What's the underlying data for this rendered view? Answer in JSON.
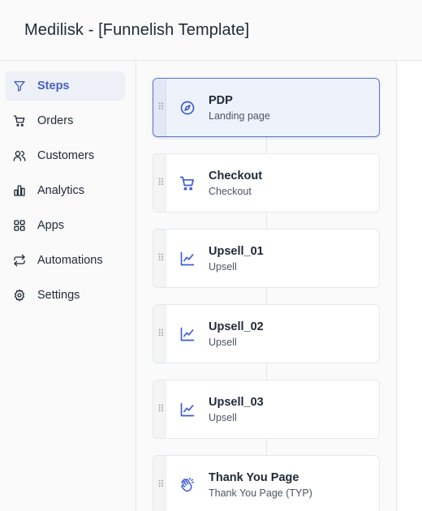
{
  "header": {
    "title": "Medilisk - [Funnelish Template]"
  },
  "sidebar": {
    "items": [
      {
        "label": "Steps",
        "icon": "funnel-icon",
        "active": true
      },
      {
        "label": "Orders",
        "icon": "cart-icon"
      },
      {
        "label": "Customers",
        "icon": "users-icon"
      },
      {
        "label": "Analytics",
        "icon": "bar-chart-icon"
      },
      {
        "label": "Apps",
        "icon": "grid-icon"
      },
      {
        "label": "Automations",
        "icon": "repeat-icon"
      },
      {
        "label": "Settings",
        "icon": "gear-icon"
      }
    ]
  },
  "steps": [
    {
      "name": "PDP",
      "type": "Landing page",
      "icon": "compass-icon",
      "selected": true
    },
    {
      "name": "Checkout",
      "type": "Checkout",
      "icon": "cart-icon"
    },
    {
      "name": "Upsell_01",
      "type": "Upsell",
      "icon": "trending-up-icon"
    },
    {
      "name": "Upsell_02",
      "type": "Upsell",
      "icon": "trending-up-icon"
    },
    {
      "name": "Upsell_03",
      "type": "Upsell",
      "icon": "trending-up-icon"
    },
    {
      "name": "Thank You Page",
      "type": "Thank You Page (TYP)",
      "icon": "clapping-hands-icon"
    }
  ],
  "colors": {
    "accent": "#4562c4",
    "icon": "#3b5bdb"
  }
}
